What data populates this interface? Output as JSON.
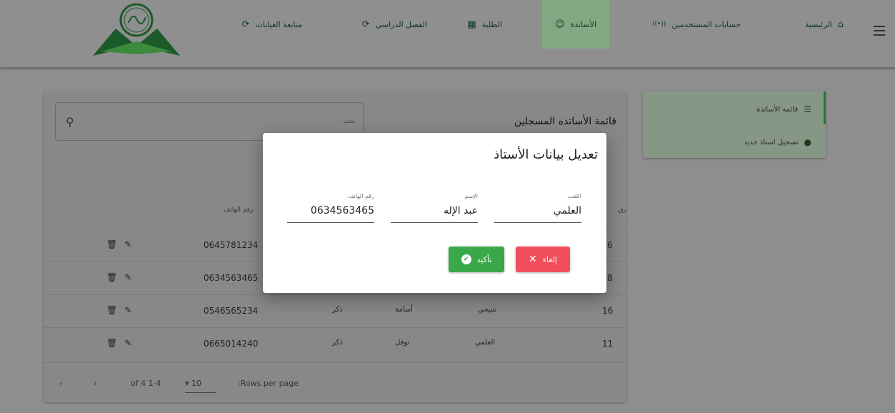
{
  "nav": {
    "home": "الرئيسية",
    "user_accounts": "حسابات المستخدمين",
    "teachers": "الأساتذة",
    "students": "الطلبة",
    "semester": "الفصل الدراسي",
    "absences": "متابعة الغيابات"
  },
  "sidebar": {
    "items": [
      {
        "label": "قائمة الأساتذة",
        "icon": "list-icon"
      },
      {
        "label": "تسجيل استاذ جديد",
        "icon": "person-icon"
      }
    ]
  },
  "main": {
    "title": "قائمة الأساتذه المسجلين",
    "search_placeholder": "بحث",
    "column_phone": "رقم الهاتف",
    "column_id_partial": "رق",
    "rows": [
      {
        "phone": "0645781234",
        "id": "6",
        "gender": "",
        "first": "",
        "last": ""
      },
      {
        "phone": "0634563465",
        "id": "8",
        "gender": "",
        "first": "",
        "last": ""
      },
      {
        "phone": "0546565234",
        "id": "16",
        "gender": "ذكر",
        "first": "أسامة",
        "last": "شيحي"
      },
      {
        "phone": "0665014240",
        "id": "11",
        "gender": "ذكر",
        "first": "نوفل",
        "last": "العلمي"
      }
    ],
    "pager": {
      "rows_per_page_label": ":Rows per page",
      "rows_per_page": "10",
      "range": "of 4 1-4"
    }
  },
  "modal": {
    "title": "تعديل بيانات الأستاذ",
    "fields": {
      "last_name": {
        "label": "اللقب",
        "value": "العلمي"
      },
      "first_name": {
        "label": "الإسم",
        "value": "عبد الإله"
      },
      "phone": {
        "label": "رقم الهاتف",
        "value": "0634563465"
      }
    },
    "cancel_label": "إلغاء",
    "confirm_label": "تأكيد"
  },
  "colors": {
    "accent_green": "#3aa84a",
    "cancel_red": "#f04e5c",
    "nav_active": "#84a884"
  }
}
